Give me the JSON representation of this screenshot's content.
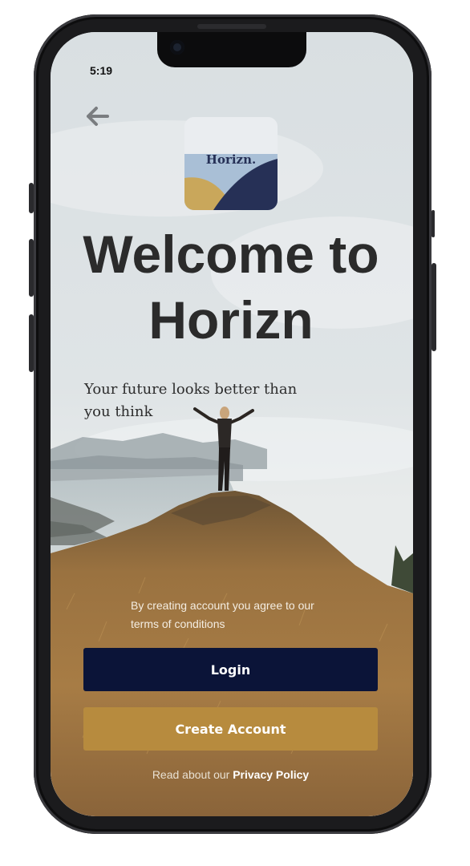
{
  "status_bar": {
    "time": "5:19"
  },
  "icons": {
    "back": "arrow-left-icon"
  },
  "logo": {
    "text": "Horizn."
  },
  "welcome": {
    "line1": "Welcome to",
    "line2": "Horizn"
  },
  "tagline": {
    "line1": "Your future looks better than",
    "line2": "you think"
  },
  "terms": {
    "line1": "By creating account you agree to our",
    "line2": "terms of conditions"
  },
  "buttons": {
    "login": "Login",
    "create_account": "Create Account"
  },
  "privacy": {
    "prefix": "Read about our ",
    "link": "Privacy Policy"
  },
  "colors": {
    "login_button": "#0b1438",
    "create_button": "#b78b3e",
    "logo_navy": "#263056",
    "logo_gold": "#c9a75b",
    "logo_sky": "#a9bfd6"
  }
}
